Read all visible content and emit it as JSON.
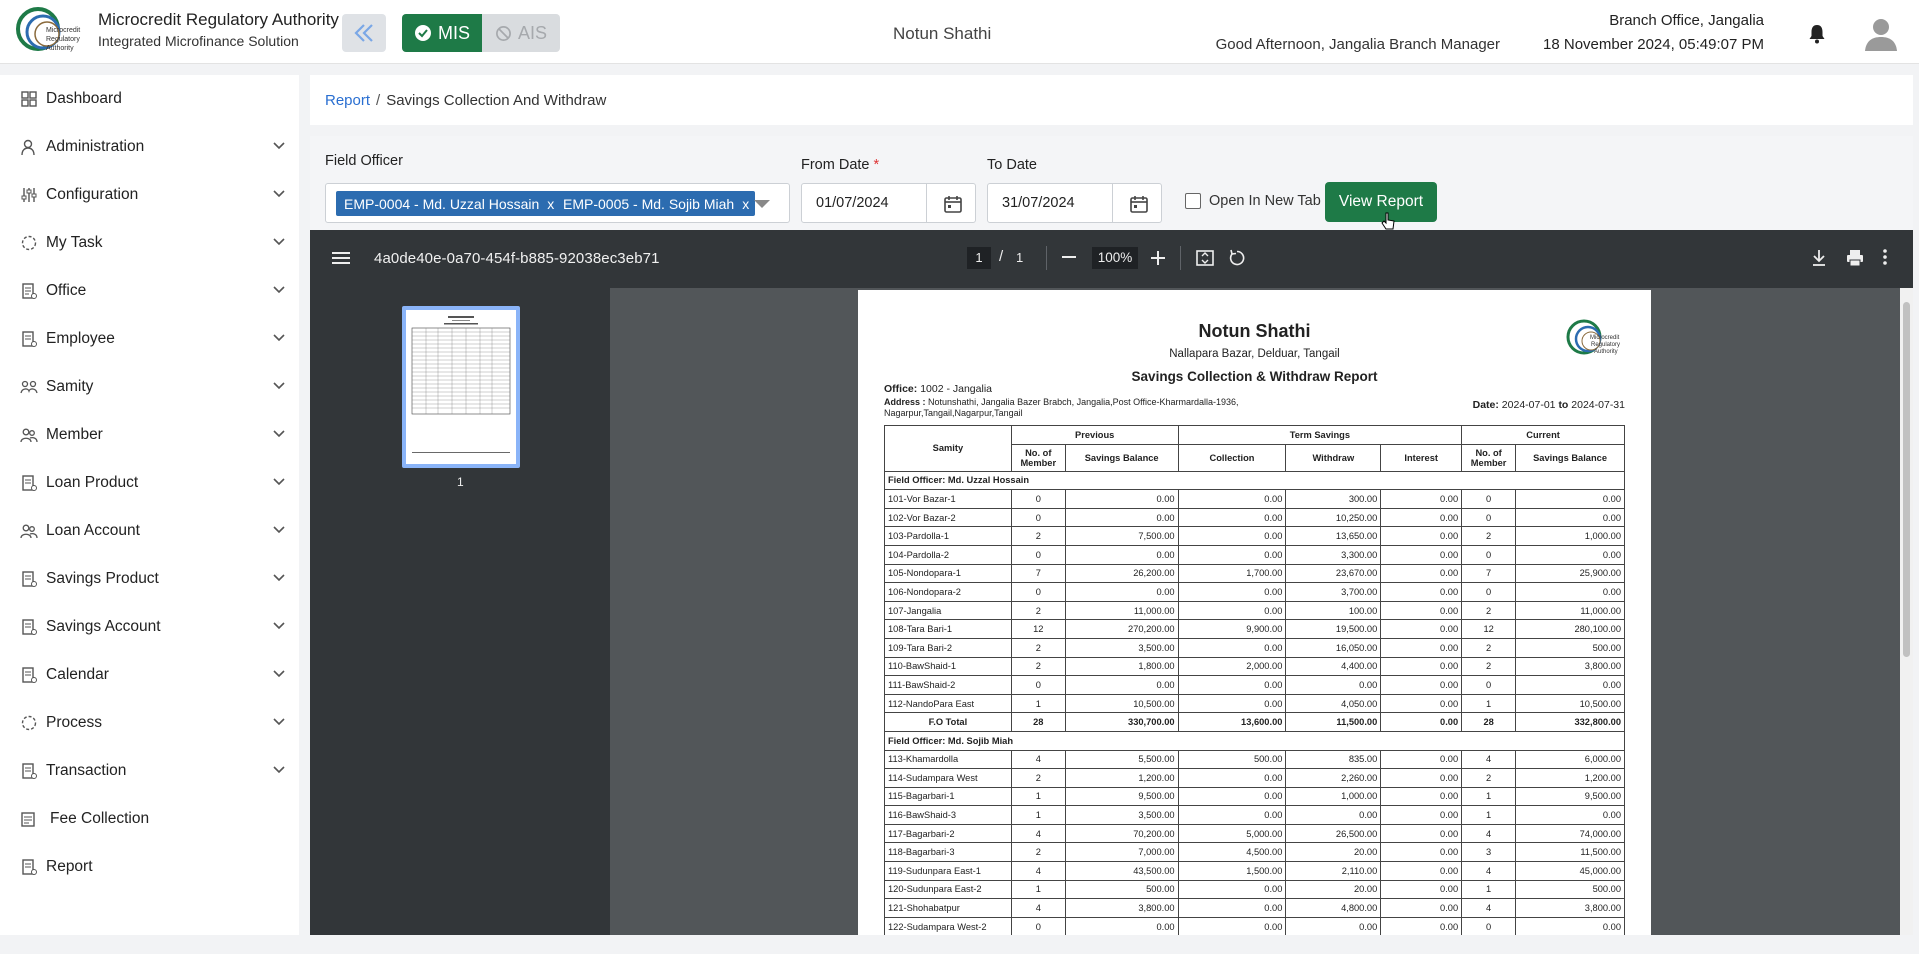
{
  "header": {
    "brand_title": "Microcredit Regulatory Authority",
    "brand_subtitle": "Integrated Microfinance Solution",
    "logo_text": "Microcredit Regulatory Authority",
    "mode_mis": "MIS",
    "mode_ais": "AIS",
    "org_name": "Notun Shathi",
    "greeting": "Good Afternoon, Jangalia Branch Manager",
    "branch": "Branch Office, Jangalia",
    "datetime": "18 November 2024, 05:49:07 PM"
  },
  "sidebar": {
    "items": [
      {
        "label": "Dashboard",
        "icon": "dashboard-icon",
        "expandable": false
      },
      {
        "label": "Administration",
        "icon": "admin-icon",
        "expandable": true
      },
      {
        "label": "Configuration",
        "icon": "config-icon",
        "expandable": true
      },
      {
        "label": "My Task",
        "icon": "task-icon",
        "expandable": true
      },
      {
        "label": "Office",
        "icon": "office-icon",
        "expandable": true
      },
      {
        "label": "Employee",
        "icon": "employee-icon",
        "expandable": true
      },
      {
        "label": "Samity",
        "icon": "samity-icon",
        "expandable": true
      },
      {
        "label": "Member",
        "icon": "member-icon",
        "expandable": true
      },
      {
        "label": "Loan Product",
        "icon": "loan-product-icon",
        "expandable": true
      },
      {
        "label": "Loan Account",
        "icon": "loan-account-icon",
        "expandable": true
      },
      {
        "label": "Savings Product",
        "icon": "savings-product-icon",
        "expandable": true
      },
      {
        "label": "Savings Account",
        "icon": "savings-account-icon",
        "expandable": true
      },
      {
        "label": "Calendar",
        "icon": "calendar-icon",
        "expandable": true
      },
      {
        "label": "Process",
        "icon": "process-icon",
        "expandable": true
      },
      {
        "label": "Transaction",
        "icon": "transaction-icon",
        "expandable": true
      },
      {
        "label": "Fee Collection",
        "icon": "fee-icon",
        "expandable": false
      },
      {
        "label": "Report",
        "icon": "report-icon",
        "expandable": false
      }
    ]
  },
  "breadcrumb": {
    "root": "Report",
    "separator": "/",
    "current": "Savings Collection And Withdraw"
  },
  "filters": {
    "field_officer_label": "Field Officer",
    "chips": [
      "EMP-0004 - Md. Uzzal Hossain",
      "EMP-0005 - Md. Sojib Miah"
    ],
    "chip_remove": "x",
    "from_date_label": "From Date",
    "required_mark": "*",
    "from_date": "01/07/2024",
    "to_date_label": "To Date",
    "to_date": "31/07/2024",
    "open_new_tab_label": "Open In New Tab",
    "view_report_label": "View Report"
  },
  "pdf_viewer": {
    "file_name": "4a0de40e-0a70-454f-b885-92038ec3eb71",
    "page_current": "1",
    "page_separator": "/",
    "page_total": "1",
    "zoom": "100%",
    "thumb_label": "1"
  },
  "report": {
    "title": "Notun Shathi",
    "address": "Nallapara Bazar, Delduar, Tangail",
    "subtitle": "Savings Collection & Withdraw Report",
    "office_label": "Office:",
    "office_value": "1002 - Jangalia",
    "address_label": "Address :",
    "address_value": "Notunshathi, Jangalia Bazer Brabch, Jangalia,Post Office-Kharmardalla-1936, Nagarpur,Tangail,Nagarpur,Tangail",
    "date_label": "Date:",
    "date_from": "2024-07-01",
    "date_to_word": "to",
    "date_to": "2024-07-31",
    "headers": {
      "samity": "Samity",
      "previous": "Previous",
      "term_savings": "Term Savings",
      "current": "Current",
      "no_of_member": "No. of Member",
      "savings_balance": "Savings Balance",
      "collection": "Collection",
      "withdraw": "Withdraw",
      "interest": "Interest"
    },
    "groups": [
      {
        "officer": "Field Officer: Md. Uzzal Hossain",
        "rows": [
          [
            "101-Vor Bazar-1",
            "0",
            "0.00",
            "0.00",
            "300.00",
            "0.00",
            "0",
            "0.00"
          ],
          [
            "102-Vor Bazar-2",
            "0",
            "0.00",
            "0.00",
            "10,250.00",
            "0.00",
            "0",
            "0.00"
          ],
          [
            "103-Pardolla-1",
            "2",
            "7,500.00",
            "0.00",
            "13,650.00",
            "0.00",
            "2",
            "1,000.00"
          ],
          [
            "104-Pardolla-2",
            "0",
            "0.00",
            "0.00",
            "3,300.00",
            "0.00",
            "0",
            "0.00"
          ],
          [
            "105-Nondopara-1",
            "7",
            "26,200.00",
            "1,700.00",
            "23,670.00",
            "0.00",
            "7",
            "25,900.00"
          ],
          [
            "106-Nondopara-2",
            "0",
            "0.00",
            "0.00",
            "3,700.00",
            "0.00",
            "0",
            "0.00"
          ],
          [
            "107-Jangalia",
            "2",
            "11,000.00",
            "0.00",
            "100.00",
            "0.00",
            "2",
            "11,000.00"
          ],
          [
            "108-Tara Bari-1",
            "12",
            "270,200.00",
            "9,900.00",
            "19,500.00",
            "0.00",
            "12",
            "280,100.00"
          ],
          [
            "109-Tara Bari-2",
            "2",
            "3,500.00",
            "0.00",
            "16,050.00",
            "0.00",
            "2",
            "500.00"
          ],
          [
            "110-BawShaid-1",
            "2",
            "1,800.00",
            "2,000.00",
            "4,400.00",
            "0.00",
            "2",
            "3,800.00"
          ],
          [
            "111-BawShaid-2",
            "0",
            "0.00",
            "0.00",
            "0.00",
            "0.00",
            "0",
            "0.00"
          ],
          [
            "112-NandoPara East",
            "1",
            "10,500.00",
            "0.00",
            "4,050.00",
            "0.00",
            "1",
            "10,500.00"
          ]
        ],
        "total": [
          "F.O Total",
          "28",
          "330,700.00",
          "13,600.00",
          "11,500.00",
          "0.00",
          "28",
          "332,800.00"
        ]
      },
      {
        "officer": "Field Officer: Md. Sojib Miah",
        "rows": [
          [
            "113-Khamardolla",
            "4",
            "5,500.00",
            "500.00",
            "835.00",
            "0.00",
            "4",
            "6,000.00"
          ],
          [
            "114-Sudampara West",
            "2",
            "1,200.00",
            "0.00",
            "2,260.00",
            "0.00",
            "2",
            "1,200.00"
          ],
          [
            "115-Bagarbari-1",
            "1",
            "9,500.00",
            "0.00",
            "1,000.00",
            "0.00",
            "1",
            "9,500.00"
          ],
          [
            "116-BawShaid-3",
            "1",
            "3,500.00",
            "0.00",
            "0.00",
            "0.00",
            "1",
            "0.00"
          ],
          [
            "117-Bagarbari-2",
            "4",
            "70,200.00",
            "5,000.00",
            "26,500.00",
            "0.00",
            "4",
            "74,000.00"
          ],
          [
            "118-Bagarbari-3",
            "2",
            "7,000.00",
            "4,500.00",
            "20.00",
            "0.00",
            "3",
            "11,500.00"
          ],
          [
            "119-Sudunpara East-1",
            "4",
            "43,500.00",
            "1,500.00",
            "2,110.00",
            "0.00",
            "4",
            "45,000.00"
          ],
          [
            "120-Sudunpara East-2",
            "1",
            "500.00",
            "0.00",
            "20.00",
            "0.00",
            "1",
            "500.00"
          ],
          [
            "121-Shohabatpur",
            "4",
            "3,800.00",
            "0.00",
            "4,800.00",
            "0.00",
            "4",
            "3,800.00"
          ],
          [
            "122-Sudampara West-2",
            "0",
            "0.00",
            "0.00",
            "0.00",
            "0.00",
            "0",
            "0.00"
          ]
        ]
      }
    ]
  }
}
